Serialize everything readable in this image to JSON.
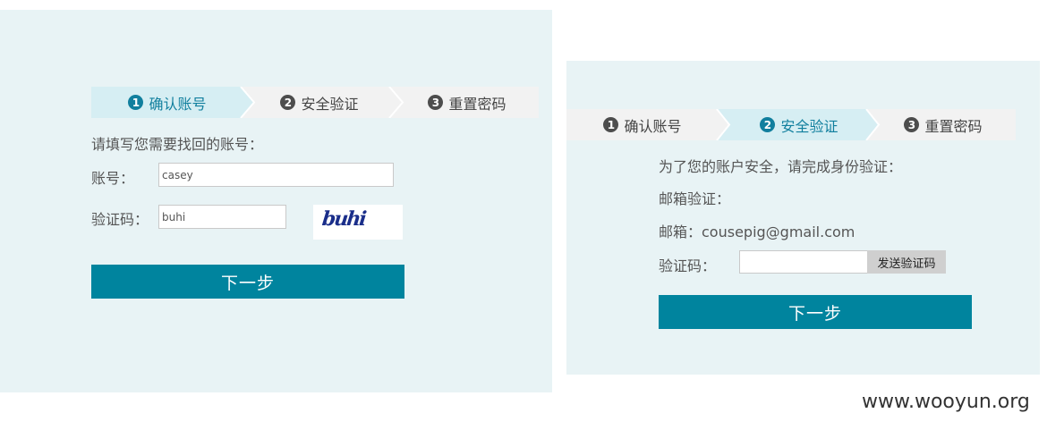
{
  "left_panel": {
    "steps": [
      {
        "num": "1",
        "label": "确认账号"
      },
      {
        "num": "2",
        "label": "安全验证"
      },
      {
        "num": "3",
        "label": "重置密码"
      }
    ],
    "prompt": "请填写您需要找回的账号：",
    "account_label": "账号：",
    "account_value": "casey",
    "captcha_label": "验证码：",
    "captcha_value": "buhi",
    "captcha_image_text": "buhi",
    "next_button": "下一步"
  },
  "right_panel": {
    "steps": [
      {
        "num": "1",
        "label": "确认账号"
      },
      {
        "num": "2",
        "label": "安全验证"
      },
      {
        "num": "3",
        "label": "重置密码"
      }
    ],
    "prompt": "为了您的账户安全，请完成身份验证：",
    "email_verify_label": "邮箱验证：",
    "email_line": "邮箱：cousepig@gmail.com",
    "captcha_label": "验证码：",
    "captcha_value": "",
    "send_code_button": "发送验证码",
    "next_button": "下一步"
  },
  "watermark": "www.wooyun.org",
  "colors": {
    "panel_bg": "#e8f3f5",
    "active_step_bg": "#d6eef3",
    "inactive_step_bg": "#f2f2f2",
    "accent": "#117f9e",
    "button_bg": "#00849e"
  }
}
